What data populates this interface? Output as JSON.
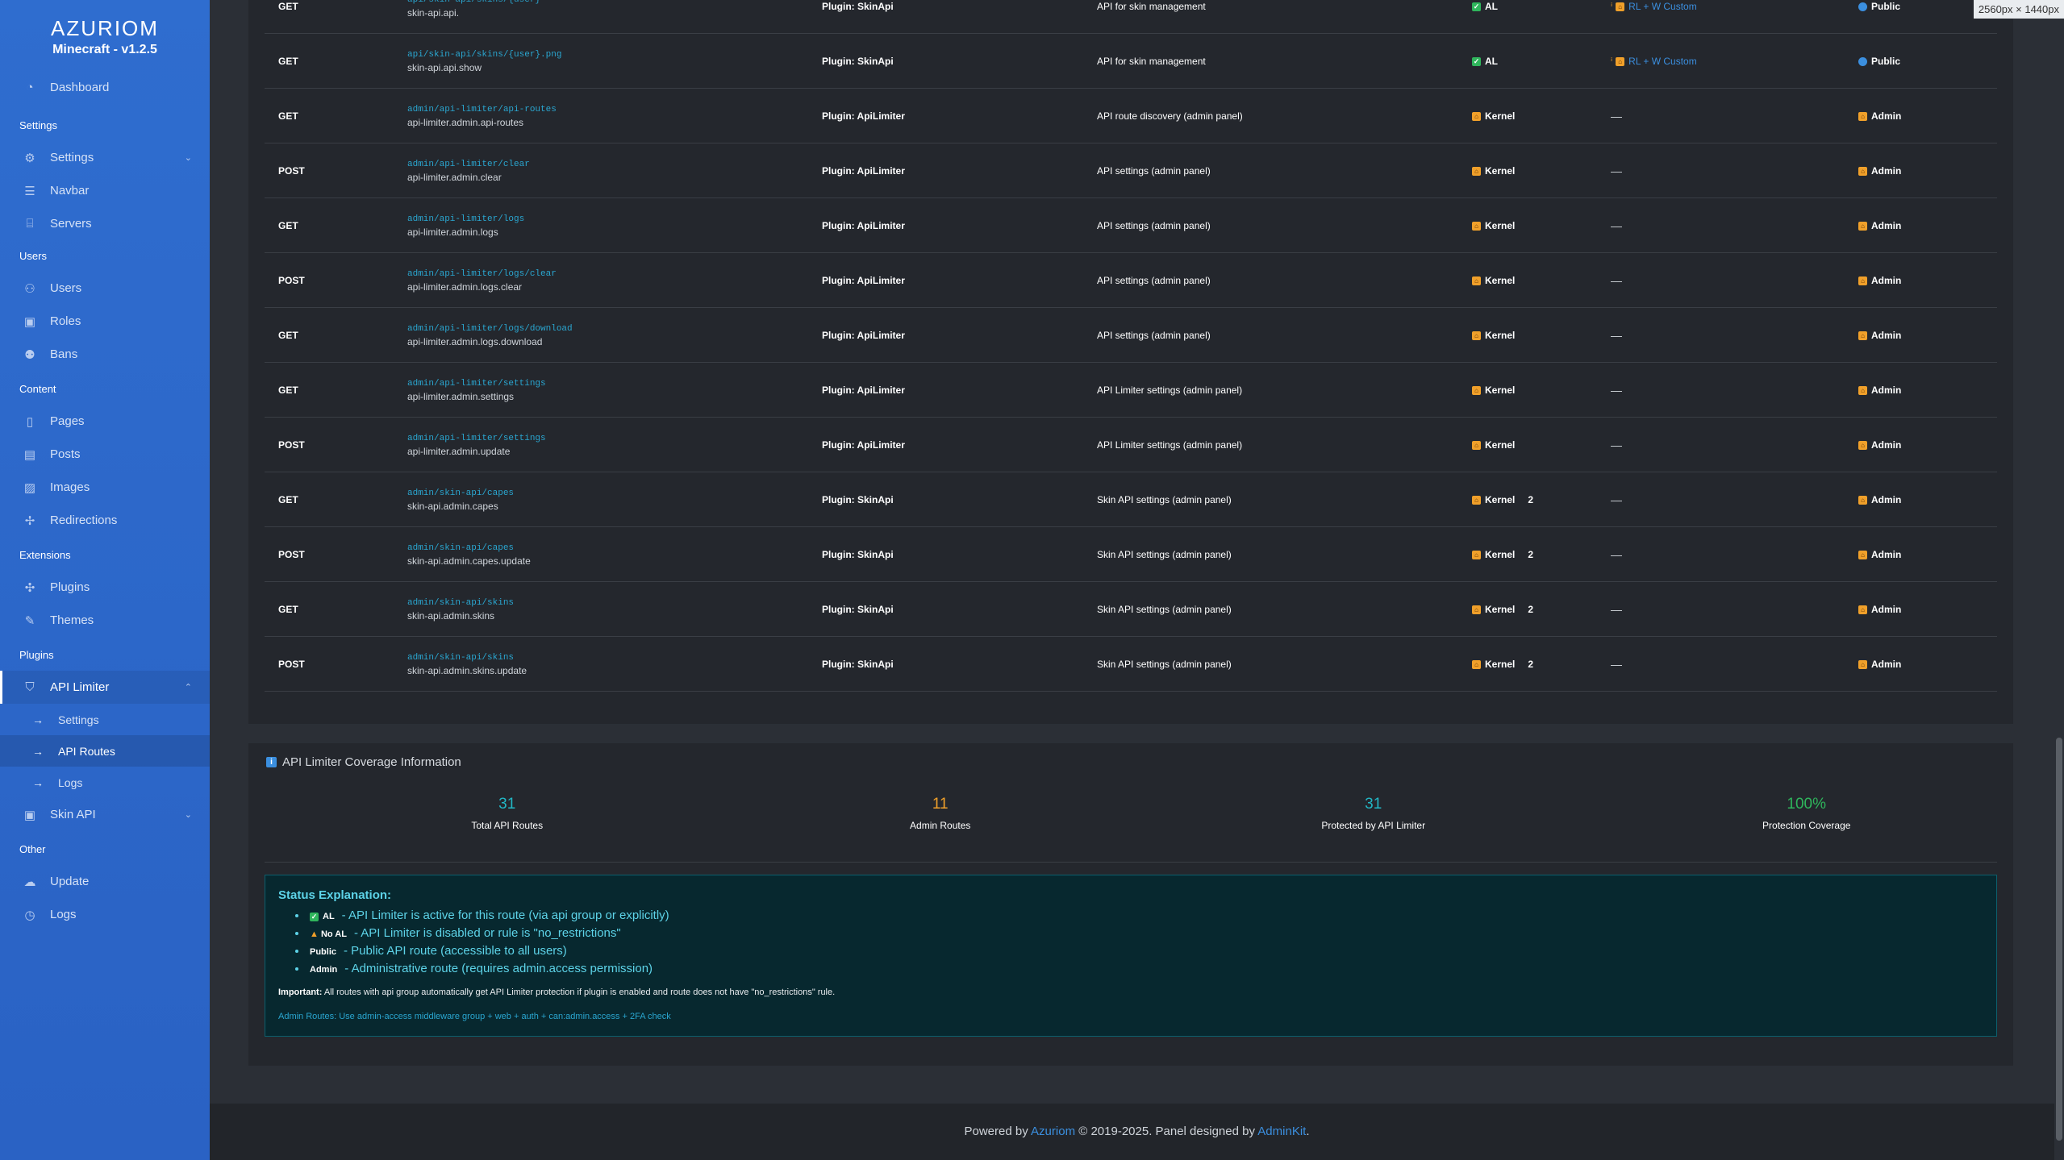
{
  "brand": {
    "logo": "AZURIOM",
    "subtitle": "Minecraft - v1.2.5"
  },
  "sidebar": {
    "dashboard": "Dashboard",
    "settings_header": "Settings",
    "settings": "Settings",
    "navbar": "Navbar",
    "servers": "Servers",
    "users_header": "Users",
    "users": "Users",
    "roles": "Roles",
    "bans": "Bans",
    "content_header": "Content",
    "pages": "Pages",
    "posts": "Posts",
    "images": "Images",
    "redirections": "Redirections",
    "extensions_header": "Extensions",
    "plugins": "Plugins",
    "themes": "Themes",
    "plugins_header": "Plugins",
    "api_limiter": "API Limiter",
    "sub_settings": "Settings",
    "sub_api_routes": "API Routes",
    "sub_logs": "Logs",
    "skin_api": "Skin API",
    "other_header": "Other",
    "update": "Update",
    "logs": "Logs"
  },
  "routes": [
    {
      "method": "GET",
      "path": "api/skin-api/skins/{user}",
      "name": "skin-api.api.",
      "plugin": "Plugin: SkinApi",
      "desc": "API for skin management",
      "middleware": "AL",
      "mw_type": "al",
      "count": "",
      "limit": "RL + W Custom",
      "access": "Public"
    },
    {
      "method": "GET",
      "path": "api/skin-api/skins/{user}.png",
      "name": "skin-api.api.show",
      "plugin": "Plugin: SkinApi",
      "desc": "API for skin management",
      "middleware": "AL",
      "mw_type": "al",
      "count": "",
      "limit": "RL + W Custom",
      "access": "Public"
    },
    {
      "method": "GET",
      "path": "admin/api-limiter/api-routes",
      "name": "api-limiter.admin.api-routes",
      "plugin": "Plugin: ApiLimiter",
      "desc": "API route discovery (admin panel)",
      "middleware": "Kernel",
      "mw_type": "kernel",
      "count": "",
      "limit": "—",
      "access": "Admin"
    },
    {
      "method": "POST",
      "path": "admin/api-limiter/clear",
      "name": "api-limiter.admin.clear",
      "plugin": "Plugin: ApiLimiter",
      "desc": "API settings (admin panel)",
      "middleware": "Kernel",
      "mw_type": "kernel",
      "count": "",
      "limit": "—",
      "access": "Admin"
    },
    {
      "method": "GET",
      "path": "admin/api-limiter/logs",
      "name": "api-limiter.admin.logs",
      "plugin": "Plugin: ApiLimiter",
      "desc": "API settings (admin panel)",
      "middleware": "Kernel",
      "mw_type": "kernel",
      "count": "",
      "limit": "—",
      "access": "Admin"
    },
    {
      "method": "POST",
      "path": "admin/api-limiter/logs/clear",
      "name": "api-limiter.admin.logs.clear",
      "plugin": "Plugin: ApiLimiter",
      "desc": "API settings (admin panel)",
      "middleware": "Kernel",
      "mw_type": "kernel",
      "count": "",
      "limit": "—",
      "access": "Admin"
    },
    {
      "method": "GET",
      "path": "admin/api-limiter/logs/download",
      "name": "api-limiter.admin.logs.download",
      "plugin": "Plugin: ApiLimiter",
      "desc": "API settings (admin panel)",
      "middleware": "Kernel",
      "mw_type": "kernel",
      "count": "",
      "limit": "—",
      "access": "Admin"
    },
    {
      "method": "GET",
      "path": "admin/api-limiter/settings",
      "name": "api-limiter.admin.settings",
      "plugin": "Plugin: ApiLimiter",
      "desc": "API Limiter settings (admin panel)",
      "middleware": "Kernel",
      "mw_type": "kernel",
      "count": "",
      "limit": "—",
      "access": "Admin"
    },
    {
      "method": "POST",
      "path": "admin/api-limiter/settings",
      "name": "api-limiter.admin.update",
      "plugin": "Plugin: ApiLimiter",
      "desc": "API Limiter settings (admin panel)",
      "middleware": "Kernel",
      "mw_type": "kernel",
      "count": "",
      "limit": "—",
      "access": "Admin"
    },
    {
      "method": "GET",
      "path": "admin/skin-api/capes",
      "name": "skin-api.admin.capes",
      "plugin": "Plugin: SkinApi",
      "desc": "Skin API settings (admin panel)",
      "middleware": "Kernel",
      "mw_type": "kernel",
      "count": "2",
      "limit": "—",
      "access": "Admin"
    },
    {
      "method": "POST",
      "path": "admin/skin-api/capes",
      "name": "skin-api.admin.capes.update",
      "plugin": "Plugin: SkinApi",
      "desc": "Skin API settings (admin panel)",
      "middleware": "Kernel",
      "mw_type": "kernel",
      "count": "2",
      "limit": "—",
      "access": "Admin"
    },
    {
      "method": "GET",
      "path": "admin/skin-api/skins",
      "name": "skin-api.admin.skins",
      "plugin": "Plugin: SkinApi",
      "desc": "Skin API settings (admin panel)",
      "middleware": "Kernel",
      "mw_type": "kernel",
      "count": "2",
      "limit": "—",
      "access": "Admin"
    },
    {
      "method": "POST",
      "path": "admin/skin-api/skins",
      "name": "skin-api.admin.skins.update",
      "plugin": "Plugin: SkinApi",
      "desc": "Skin API settings (admin panel)",
      "middleware": "Kernel",
      "mw_type": "kernel",
      "count": "2",
      "limit": "—",
      "access": "Admin"
    }
  ],
  "coverage": {
    "title": "API Limiter Coverage Information",
    "stats": [
      {
        "value": "31",
        "label": "Total API Routes",
        "color": "#22b6c4"
      },
      {
        "value": "11",
        "label": "Admin Routes",
        "color": "#f0a02a"
      },
      {
        "value": "31",
        "label": "Protected by API Limiter",
        "color": "#22b6c4"
      },
      {
        "value": "100%",
        "label": "Protection Coverage",
        "color": "#2fb55c"
      }
    ],
    "explanation": {
      "heading": "Status Explanation:",
      "al_tag": "AL",
      "al_text": "- API Limiter is active for this route (via api group or explicitly)",
      "noal_tag": "No AL",
      "noal_text": "- API Limiter is disabled or rule is \"no_restrictions\"",
      "public_tag": "Public",
      "public_text": "- Public API route (accessible to all users)",
      "admin_tag": "Admin",
      "admin_text": "- Administrative route (requires admin.access permission)",
      "important_label": "Important:",
      "important_text": "All routes with api group automatically get API Limiter protection if plugin is enabled and route does not have \"no_restrictions\" rule.",
      "admin_routes_label": "Admin Routes:",
      "admin_routes_text": "Use admin-access middleware group + web + auth + can:admin.access + 2FA check"
    }
  },
  "footer": {
    "prefix": "Powered by",
    "azuriom": "Azuriom",
    "middle": "© 2019-2025. Panel designed by",
    "adminkit": "AdminKit",
    "suffix": "."
  },
  "dims_label": "2560px × 1440px"
}
